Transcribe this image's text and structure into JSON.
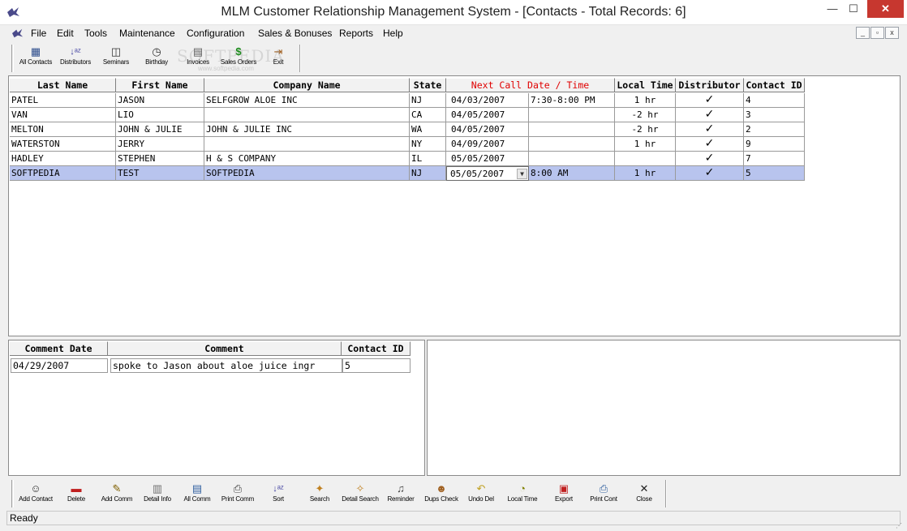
{
  "window": {
    "title": "MLM Customer Relationship Management System - [Contacts - Total Records: 6]",
    "minimize_glyph": "—",
    "maximize_glyph": "☐",
    "close_glyph": "✕",
    "app_icon": "bird-logo-icon"
  },
  "menu": {
    "items": [
      "File",
      "Edit",
      "Tools",
      "Maintenance",
      "Configuration",
      "Sales & Bonuses",
      "Reports",
      "Help"
    ],
    "mdi_minimize": "_",
    "mdi_restore": "▫",
    "mdi_close": "x"
  },
  "top_toolbar": {
    "buttons": [
      {
        "label": "All Contacts",
        "icon": "contacts-icon",
        "glyph": "▦"
      },
      {
        "label": "Distributors",
        "icon": "sort-az-icon",
        "glyph": "↓ᵃᶻ"
      },
      {
        "label": "Seminars",
        "icon": "projector-icon",
        "glyph": "◫"
      },
      {
        "label": "Birthday",
        "icon": "clock-icon",
        "glyph": "◷"
      },
      {
        "label": "Invoices",
        "icon": "invoice-icon",
        "glyph": "▤"
      },
      {
        "label": "Sales Orders",
        "icon": "money-bag-icon",
        "glyph": "$"
      },
      {
        "label": "Exit",
        "icon": "exit-door-icon",
        "glyph": "⇥"
      }
    ]
  },
  "watermark": {
    "text": "SOFTPEDIA",
    "sub": "www.softpedia.com"
  },
  "contacts_grid": {
    "columns": [
      "Last Name",
      "First Name",
      "Company Name",
      "State",
      "Next Call Date / Time",
      "Local Time",
      "Distributor",
      "Contact ID"
    ],
    "rows": [
      {
        "last": "PATEL",
        "first": "JASON",
        "company": "SELFGROW ALOE INC",
        "state": "NJ",
        "date": "04/03/2007",
        "time": "7:30-8:00 PM",
        "local": "1 hr",
        "dist": "✓",
        "id": "4"
      },
      {
        "last": "VAN",
        "first": "LIO",
        "company": "",
        "state": "CA",
        "date": "04/05/2007",
        "time": "",
        "local": "-2 hr",
        "dist": "✓",
        "id": "3"
      },
      {
        "last": "MELTON",
        "first": "JOHN & JULIE",
        "company": "JOHN & JULIE INC",
        "state": "WA",
        "date": "04/05/2007",
        "time": "",
        "local": "-2 hr",
        "dist": "✓",
        "id": "2"
      },
      {
        "last": "WATERSTON",
        "first": "JERRY",
        "company": "",
        "state": "NY",
        "date": "04/09/2007",
        "time": "",
        "local": "1 hr",
        "dist": "✓",
        "id": "9"
      },
      {
        "last": "HADLEY",
        "first": "STEPHEN",
        "company": "H & S COMPANY",
        "state": "IL",
        "date": "05/05/2007",
        "time": "",
        "local": "",
        "dist": "✓",
        "id": "7"
      },
      {
        "last": "SOFTPEDIA",
        "first": "TEST",
        "company": "SOFTPEDIA",
        "state": "NJ",
        "date": "05/05/2007",
        "time": "8:00 AM",
        "local": "1 hr",
        "dist": "✓",
        "id": "5"
      }
    ],
    "combo_arrow": "▼"
  },
  "comments_grid": {
    "columns": [
      "Comment Date",
      "Comment",
      "Contact ID"
    ],
    "rows": [
      {
        "date": "04/29/2007",
        "comment": "spoke to Jason about aloe juice ingr",
        "id": "5"
      }
    ]
  },
  "bottom_toolbar": {
    "buttons": [
      {
        "label": "Add Contact",
        "icon": "add-contact-icon",
        "glyph": "☺"
      },
      {
        "label": "Delete",
        "icon": "delete-icon",
        "glyph": "▬"
      },
      {
        "label": "Add Comm",
        "icon": "add-comment-icon",
        "glyph": "✎"
      },
      {
        "label": "Detail Info",
        "icon": "clipboard-icon",
        "glyph": "▥"
      },
      {
        "label": "All Comm",
        "icon": "document-icon",
        "glyph": "▤"
      },
      {
        "label": "Print Comm",
        "icon": "printer-icon",
        "glyph": "⎙"
      },
      {
        "label": "Sort",
        "icon": "sort-az-icon",
        "glyph": "↓ᵃᶻ"
      },
      {
        "label": "Search",
        "icon": "flashlight-icon",
        "glyph": "✦"
      },
      {
        "label": "Detail Search",
        "icon": "detail-search-icon",
        "glyph": "✧"
      },
      {
        "label": "Reminder",
        "icon": "bell-icon",
        "glyph": "♫"
      },
      {
        "label": "Dups Check",
        "icon": "people-icon",
        "glyph": "☻"
      },
      {
        "label": "Undo Del",
        "icon": "undo-arrow-icon",
        "glyph": "↶"
      },
      {
        "label": "Local Time",
        "icon": "alarm-clock-icon",
        "glyph": "◔"
      },
      {
        "label": "Export",
        "icon": "export-icon",
        "glyph": "▣"
      },
      {
        "label": "Print Cont",
        "icon": "printer-icon",
        "glyph": "⎙"
      },
      {
        "label": "Close",
        "icon": "close-icon",
        "glyph": "✕"
      }
    ]
  },
  "status": {
    "text": "Ready",
    "grip": "⋰"
  },
  "colors": {
    "selected_row": "#b8c4ee",
    "header_accent": "#e00000",
    "close_button": "#c7372f"
  }
}
